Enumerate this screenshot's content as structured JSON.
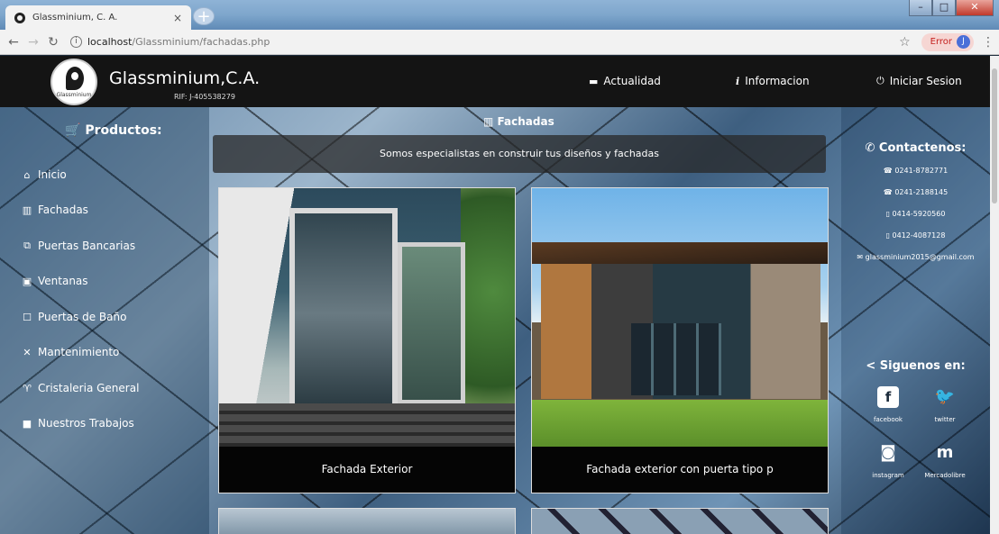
{
  "browser": {
    "tab_title": "Glassminium, C. A.",
    "tab_close": "×",
    "new_tab": "+",
    "url_host": "localhost",
    "url_path": "/Glassminium/fachadas.php",
    "error_label": "Error",
    "profile_initial": "J"
  },
  "header": {
    "logo_text": "Glassminium",
    "brand": "Glassminium,C.A.",
    "rif": "RIF: J-405538279",
    "nav": [
      {
        "label": "Actualidad",
        "icon": "calendar-icon"
      },
      {
        "label": "Informacion",
        "icon": "info-icon"
      },
      {
        "label": "Iniciar Sesion",
        "icon": "power-icon"
      }
    ]
  },
  "sidebar": {
    "title": "Productos:",
    "items": [
      {
        "label": "Inicio",
        "icon": "home-icon"
      },
      {
        "label": "Fachadas",
        "icon": "columns-icon"
      },
      {
        "label": "Puertas Bancarias",
        "icon": "copy-icon"
      },
      {
        "label": "Ventanas",
        "icon": "window-icon"
      },
      {
        "label": "Puertas de Baño",
        "icon": "door-icon"
      },
      {
        "label": "Mantenimiento",
        "icon": "tools-icon"
      },
      {
        "label": "Cristaleria General",
        "icon": "glasses-icon"
      },
      {
        "label": "Nuestros Trabajos",
        "icon": "briefcase-icon"
      }
    ]
  },
  "main": {
    "section_title": "Fachadas",
    "banner": "Somos especialistas en construir tus diseños y fachadas",
    "cards": [
      {
        "caption": "Fachada Exterior"
      },
      {
        "caption": "Fachada exterior con puerta tipo p"
      }
    ]
  },
  "contact": {
    "title": "Contactenos:",
    "phones": [
      "0241-8782771",
      "0241-2188145"
    ],
    "mobiles": [
      "0414-5920560",
      "0412-4087128"
    ],
    "email": "glassminium2015@gmail.com",
    "follow_title": "Siguenos en:",
    "social": [
      {
        "label": "facebook",
        "icon": "facebook-icon",
        "glyph": "f"
      },
      {
        "label": "twitter",
        "icon": "twitter-icon",
        "glyph": "🐦"
      },
      {
        "label": "instagram",
        "icon": "instagram-icon",
        "glyph": "◙"
      },
      {
        "label": "Mercadolibre",
        "icon": "mercadolibre-icon",
        "glyph": "m"
      }
    ]
  }
}
